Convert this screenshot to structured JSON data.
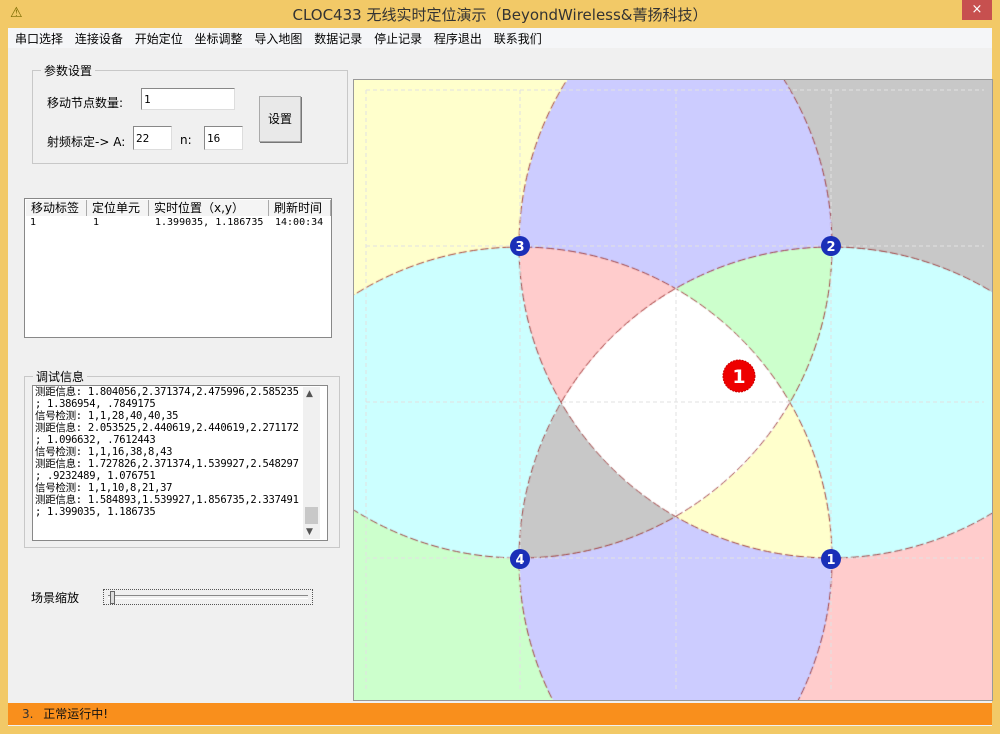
{
  "window": {
    "title": "CLOC433 无线实时定位演示（BeyondWireless&菁扬科技）",
    "close": "×"
  },
  "menu": [
    "串口选择",
    "连接设备",
    "开始定位",
    "坐标调整",
    "导入地图",
    "数据记录",
    "停止记录",
    "程序退出",
    "联系我们"
  ],
  "params": {
    "legend": "参数设置",
    "node_count_label": "移动节点数量:",
    "node_count": "1",
    "rf_label": "射频标定-> A:",
    "A": "22",
    "n_label": "n:",
    "n": "16",
    "set_button": "设置"
  },
  "table": {
    "headers": [
      "移动标签",
      "定位单元",
      "实时位置（x,y）",
      "刷新时间"
    ],
    "rows": [
      [
        "1",
        "1",
        "1.399035, 1.186735",
        "14:00:34"
      ]
    ]
  },
  "debug": {
    "legend": "调试信息",
    "lines": [
      "测距信息: 1.804056,2.371374,2.475996,2.585235",
      "; 1.386954, .7849175",
      "信号检测: 1,1,28,40,40,35",
      "测距信息: 2.053525,2.440619,2.440619,2.271172",
      "; 1.096632, .7612443",
      "信号检测: 1,1,16,38,8,43",
      "测距信息: 1.727826,2.371374,1.539927,2.548297",
      "; .9232489, 1.076751",
      "信号检测: 1,1,10,8,21,37",
      "测距信息: 1.584893,1.539927,1.856735,2.337491",
      "; 1.399035, 1.186735"
    ]
  },
  "zoom": {
    "label": "场景缩放",
    "value": 0
  },
  "map": {
    "anchors": [
      "1",
      "2",
      "3",
      "4"
    ],
    "tag": "1",
    "region_colors": {
      "1": "#ffcccc",
      "2": "#c8c8c8",
      "3": "#ffffcc",
      "4": "#ccffcc",
      "top_bottom_pair": "#ccccff",
      "side_pair": "#ccffff",
      "all": "#ffffff"
    }
  },
  "status": {
    "index": "3.",
    "text": "正常运行中!"
  }
}
